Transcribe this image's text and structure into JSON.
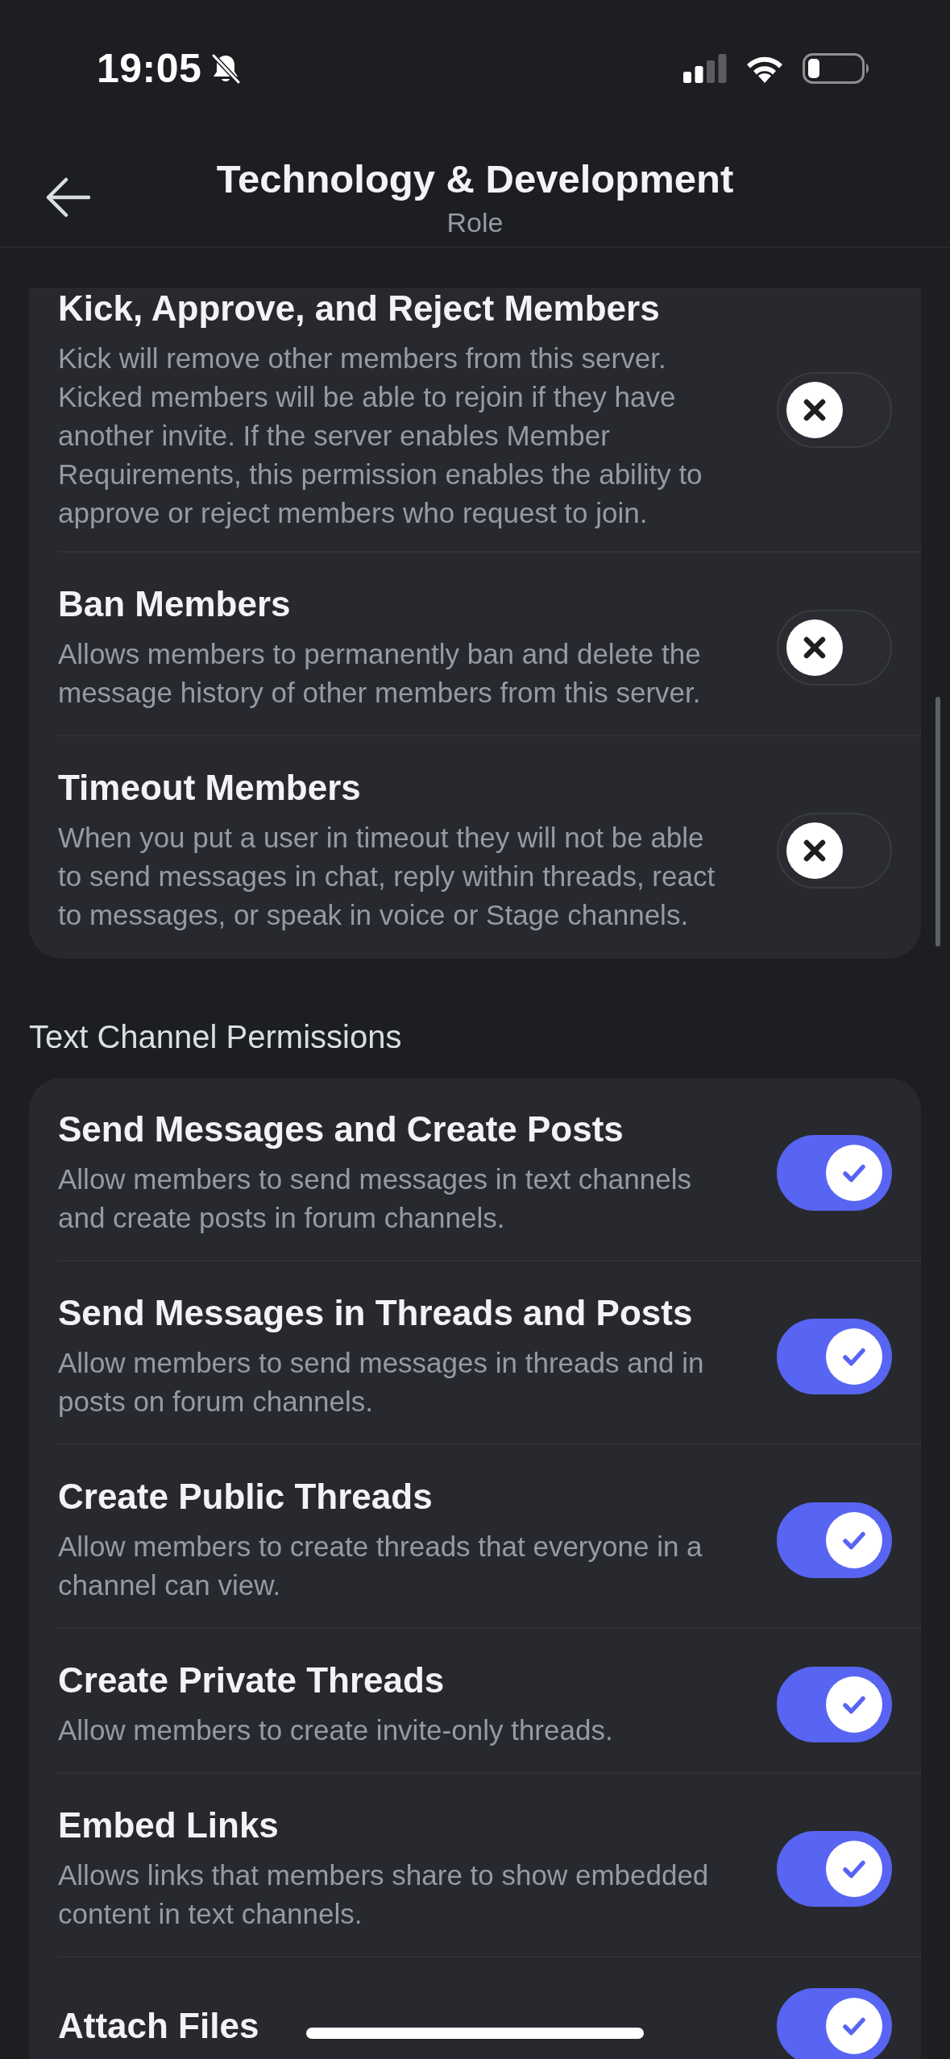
{
  "status_bar": {
    "time": "19:05"
  },
  "header": {
    "title": "Technology & Development",
    "subtitle": "Role"
  },
  "sections": [
    {
      "items": [
        {
          "title": "Kick, Approve, and Reject Members",
          "description": "Kick will remove other members from this server. Kicked members will be able to rejoin if they have another invite. If the server enables Member Requirements, this permission enables the ability to approve or reject members who request to join.",
          "on": false
        },
        {
          "title": "Ban Members",
          "description": "Allows members to permanently ban and delete the message history of other members from this server.",
          "on": false
        },
        {
          "title": "Timeout Members",
          "description": "When you put a user in timeout they will not be able to send messages in chat, reply within threads, react to messages, or speak in voice or Stage channels.",
          "on": false
        }
      ]
    },
    {
      "title": "Text Channel Permissions",
      "items": [
        {
          "title": "Send Messages and Create Posts",
          "description": "Allow members to send messages in text channels and create posts in forum channels.",
          "on": true
        },
        {
          "title": "Send Messages in Threads and Posts",
          "description": "Allow members to send messages in threads and in posts on forum channels.",
          "on": true
        },
        {
          "title": "Create Public Threads",
          "description": "Allow members to create threads that everyone in a channel can view.",
          "on": true
        },
        {
          "title": "Create Private Threads",
          "description": "Allow members to create invite-only threads.",
          "on": true
        },
        {
          "title": "Embed Links",
          "description": "Allows links that members share to show embedded content in text channels.",
          "on": true
        },
        {
          "title": "Attach Files",
          "on": true
        }
      ]
    }
  ]
}
